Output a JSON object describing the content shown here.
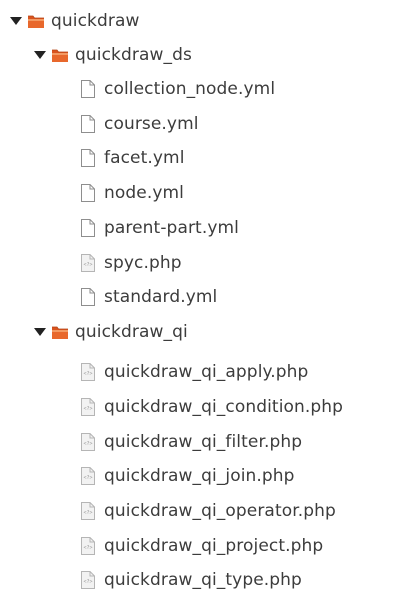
{
  "tree": {
    "root": {
      "label": "quickdraw",
      "expanded": true,
      "icon": "folder-icon",
      "children": [
        {
          "label": "quickdraw_ds",
          "expanded": true,
          "icon": "folder-icon",
          "files": [
            {
              "label": "collection_node.yml",
              "icon": "text-file-icon"
            },
            {
              "label": "course.yml",
              "icon": "text-file-icon"
            },
            {
              "label": "facet.yml",
              "icon": "text-file-icon"
            },
            {
              "label": "node.yml",
              "icon": "text-file-icon"
            },
            {
              "label": "parent-part.yml",
              "icon": "text-file-icon"
            },
            {
              "label": "spyc.php",
              "icon": "php-file-icon"
            },
            {
              "label": "standard.yml",
              "icon": "text-file-icon"
            }
          ]
        },
        {
          "label": "quickdraw_qi",
          "expanded": true,
          "icon": "folder-icon",
          "files": [
            {
              "label": "quickdraw_qi_apply.php",
              "icon": "php-file-icon"
            },
            {
              "label": "quickdraw_qi_condition.php",
              "icon": "php-file-icon"
            },
            {
              "label": "quickdraw_qi_filter.php",
              "icon": "php-file-icon"
            },
            {
              "label": "quickdraw_qi_join.php",
              "icon": "php-file-icon"
            },
            {
              "label": "quickdraw_qi_operator.php",
              "icon": "php-file-icon"
            },
            {
              "label": "quickdraw_qi_project.php",
              "icon": "php-file-icon"
            },
            {
              "label": "quickdraw_qi_type.php",
              "icon": "php-file-icon"
            }
          ]
        }
      ]
    }
  },
  "colors": {
    "text": "#3c3c3c",
    "folder_top": "#f08a4b",
    "folder_body": "#d9531e",
    "arrow": "#222222",
    "file_outline": "#8e8e8e",
    "file_fill": "#ffffff",
    "php_fill": "#f2f2f2"
  }
}
